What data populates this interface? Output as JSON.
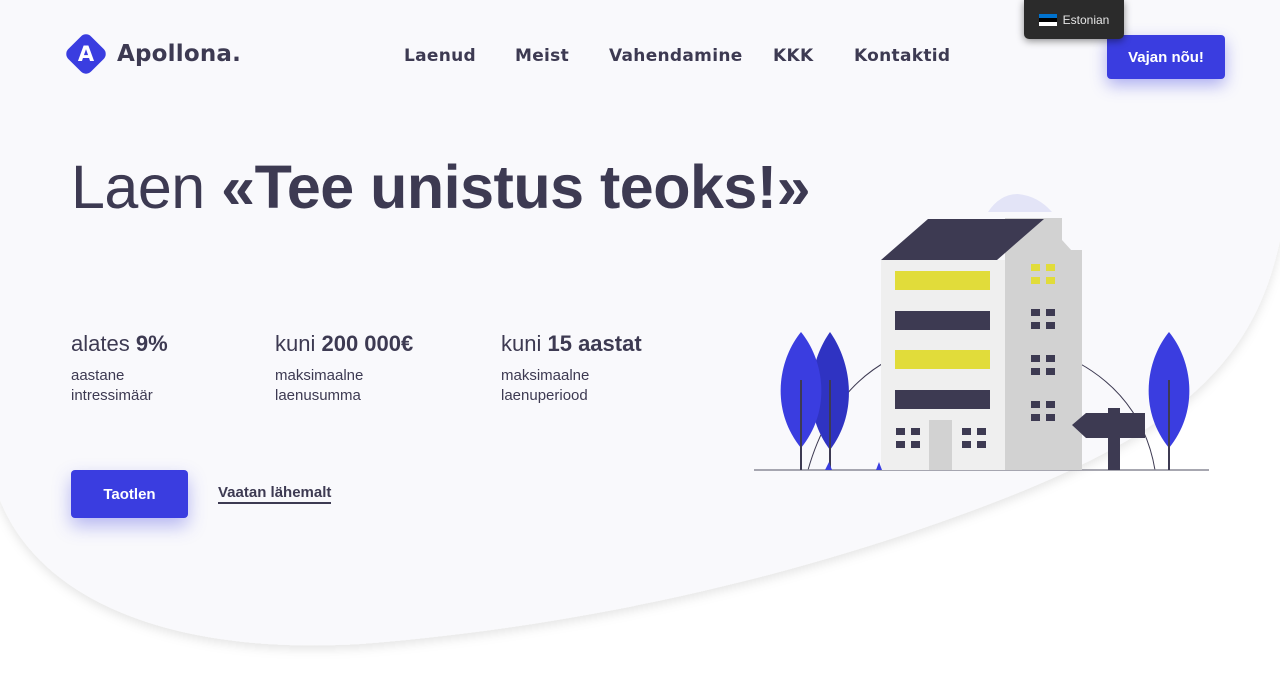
{
  "brand": {
    "name": "Apollona.",
    "logo_letter": "A",
    "accent": "#3a3de0",
    "text_color": "#3d3a52"
  },
  "nav": {
    "items": [
      "Laenud",
      "Meist",
      "Vahendamine",
      "KKK",
      "Kontaktid"
    ]
  },
  "language": {
    "label": "Estonian",
    "icon": "estonia-flag-icon"
  },
  "header_cta": "Vajan nõu!",
  "hero": {
    "title_light": "Laen ",
    "title_bold": "«Tee unistus teoks!»",
    "stats": [
      {
        "prefix": "alates ",
        "value": "9%",
        "desc_1": "aastane",
        "desc_2": "intressimäär"
      },
      {
        "prefix": "kuni ",
        "value": "200 000€",
        "desc_1": "maksimaalne",
        "desc_2": "laenusumma"
      },
      {
        "prefix": "kuni ",
        "value": "15 aastat",
        "desc_1": "maksimaalne",
        "desc_2": "laenuperiood"
      }
    ],
    "apply_label": "Taotlen",
    "more_label": "Vaatan lähemalt"
  },
  "illustration": {
    "icon": "apartment-building-illustration"
  }
}
